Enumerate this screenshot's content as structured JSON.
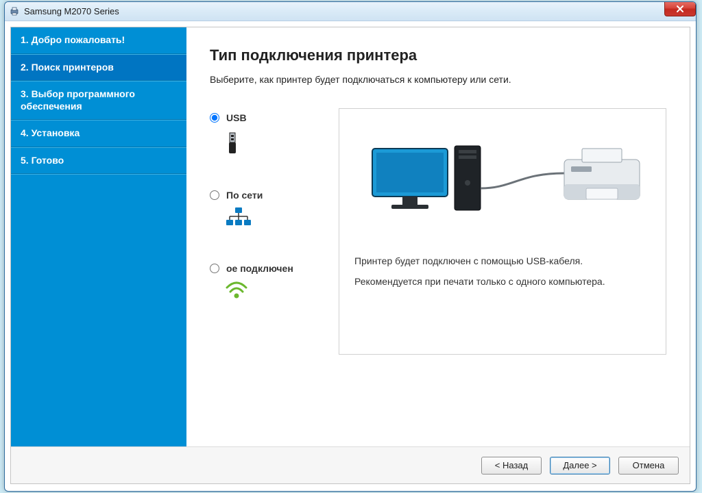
{
  "window": {
    "title": "Samsung M2070 Series",
    "close_label": "Close"
  },
  "sidebar": {
    "steps": [
      {
        "label": "1. Добро пожаловать!",
        "active": false
      },
      {
        "label": "2. Поиск принтеров",
        "active": true
      },
      {
        "label": "3. Выбор программного обеспечения",
        "active": false
      },
      {
        "label": "4. Установка",
        "active": false
      },
      {
        "label": "5. Готово",
        "active": false
      }
    ]
  },
  "main": {
    "title": "Тип подключения принтера",
    "subtitle": "Выберите, как принтер будет подключаться к компьютеру или сети.",
    "options": {
      "usb": {
        "label": "USB",
        "selected": true
      },
      "network": {
        "label": "По сети",
        "selected": false
      },
      "wireless": {
        "label": "ое подключен",
        "selected": false
      }
    },
    "detail": {
      "line1": "Принтер будет подключен с помощью USB-кабеля.",
      "line2": "Рекомендуется при печати только с одного компьютера."
    }
  },
  "footer": {
    "back": "< Назад",
    "next": "Далее >",
    "cancel": "Отмена"
  }
}
